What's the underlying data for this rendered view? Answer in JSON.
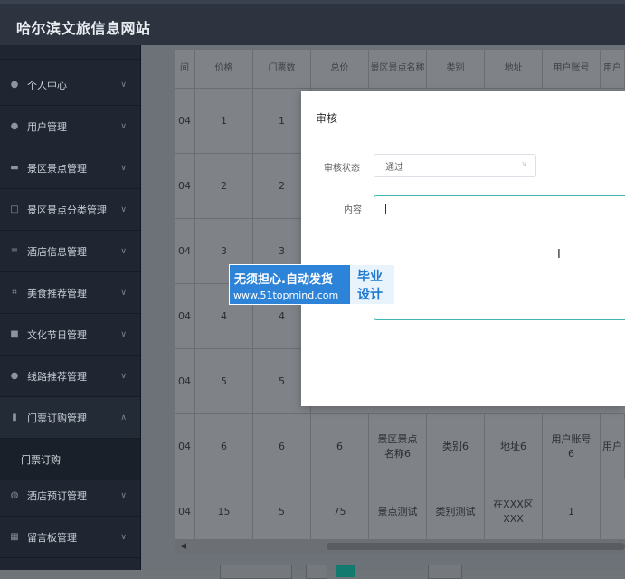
{
  "header": {
    "site_title": "哈尔滨文旅信息网站"
  },
  "sidebar": {
    "items": [
      {
        "label": "个人中心",
        "icon": "user-icon"
      },
      {
        "label": "用户管理",
        "icon": "user-icon"
      },
      {
        "label": "景区景点管理",
        "icon": "ticket-icon"
      },
      {
        "label": "景区景点分类管理",
        "icon": "crop-icon"
      },
      {
        "label": "酒店信息管理",
        "icon": "list-icon"
      },
      {
        "label": "美食推荐管理",
        "icon": "scan-icon"
      },
      {
        "label": "文化节日管理",
        "icon": "briefcase-icon"
      },
      {
        "label": "线路推荐管理",
        "icon": "user-icon"
      },
      {
        "label": "门票订购管理",
        "icon": "chart-icon"
      },
      {
        "label": "酒店预订管理",
        "icon": "globe-icon"
      },
      {
        "label": "留言板管理",
        "icon": "grid-icon"
      }
    ],
    "open_submenu": {
      "label": "门票订购"
    }
  },
  "table": {
    "headers": [
      "间",
      "价格",
      "门票数",
      "总价",
      "景区景点名称",
      "类别",
      "地址",
      "用户账号",
      "用户"
    ],
    "rows": [
      [
        "04",
        "1",
        "1",
        "",
        "",
        "",
        "",
        "",
        ""
      ],
      [
        "04",
        "2",
        "2",
        "",
        "",
        "",
        "",
        "",
        ""
      ],
      [
        "04",
        "3",
        "3",
        "",
        "",
        "",
        "",
        "",
        ""
      ],
      [
        "04",
        "4",
        "4",
        "",
        "",
        "",
        "",
        "",
        ""
      ],
      [
        "04",
        "5",
        "5",
        "",
        "",
        "",
        "",
        "",
        ""
      ],
      [
        "04",
        "6",
        "6",
        "6",
        "景区景点名称6",
        "类别6",
        "地址6",
        "用户账号6",
        "用户"
      ],
      [
        "04",
        "15",
        "5",
        "75",
        "景点测试",
        "类别测试",
        "在XXX区XXX",
        "1",
        ""
      ]
    ]
  },
  "modal": {
    "title": "审核",
    "status_label": "审核状态",
    "status_value": "通过",
    "content_label": "内容",
    "content_value": ""
  },
  "watermark": {
    "line1": "无须担心.自动发货",
    "line2": "www.51topmind.com",
    "right1": "毕业",
    "right2": "设计"
  },
  "colors": {
    "accent": "#3eb5b0",
    "sidebar_bg": "#1f2631",
    "pagination_active": "#137a70"
  }
}
